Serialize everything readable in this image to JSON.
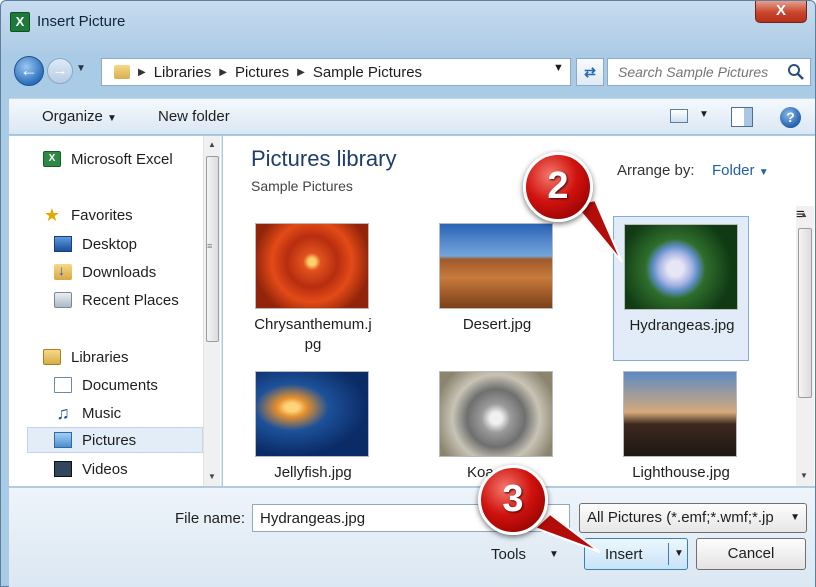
{
  "window": {
    "title": "Insert Picture",
    "close_label": "X"
  },
  "address": {
    "crumbs": [
      "Libraries",
      "Pictures",
      "Sample Pictures"
    ],
    "search_placeholder": "Search Sample Pictures"
  },
  "toolbar": {
    "organize_label": "Organize",
    "new_folder_label": "New folder",
    "help_label": "?"
  },
  "sidebar": {
    "items": [
      {
        "label": "Microsoft Excel",
        "icon": "excel-icon"
      },
      {
        "label": "Favorites",
        "icon": "star-icon"
      },
      {
        "label": "Desktop",
        "icon": "desktop-icon"
      },
      {
        "label": "Downloads",
        "icon": "downloads-icon"
      },
      {
        "label": "Recent Places",
        "icon": "recent-places-icon"
      },
      {
        "label": "Libraries",
        "icon": "libraries-icon"
      },
      {
        "label": "Documents",
        "icon": "documents-icon"
      },
      {
        "label": "Music",
        "icon": "music-icon"
      },
      {
        "label": "Pictures",
        "icon": "pictures-icon",
        "selected": true
      },
      {
        "label": "Videos",
        "icon": "videos-icon"
      }
    ]
  },
  "library": {
    "title": "Pictures library",
    "subtitle": "Sample Pictures",
    "arrange_label": "Arrange by:",
    "arrange_value": "Folder"
  },
  "files": [
    {
      "name": "Chrysanthemum.jpg",
      "label_line1": "Chrysanthemum.j",
      "label_line2": "pg"
    },
    {
      "name": "Desert.jpg"
    },
    {
      "name": "Hydrangeas.jpg",
      "selected": true
    },
    {
      "name": "Jellyfish.jpg"
    },
    {
      "name": "Koa"
    },
    {
      "name": "Lighthouse.jpg"
    }
  ],
  "bottom": {
    "file_name_label": "File name:",
    "file_name_value": "Hydrangeas.jpg",
    "filter_value": "All Pictures (*.emf;*.wmf;*.jp",
    "tools_label": "Tools",
    "insert_label": "Insert",
    "cancel_label": "Cancel"
  },
  "callouts": {
    "step2": "2",
    "step3": "3",
    "color": "#d0120e"
  }
}
